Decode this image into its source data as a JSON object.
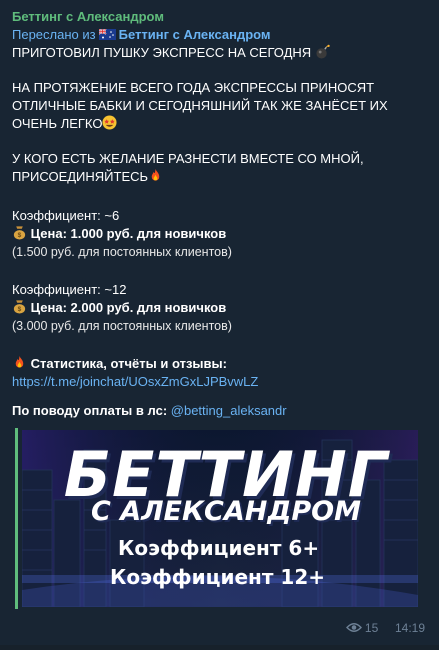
{
  "message": {
    "sender": "Беттинг с Александром",
    "forwarded_prefix": "Переслано из",
    "forwarded_from": "Беттинг с Александром",
    "lines": {
      "l1": "ПРИГОТОВИЛ ПУШКУ ЭКСПРЕСС НА СЕГОДНЯ",
      "l2": "НА ПРОТЯЖЕНИЕ ВСЕГО ГОДА ЭКСПРЕССЫ ПРИНОСЯТ",
      "l3": "ОТЛИЧНЫЕ БАБКИ И СЕГОДНЯШНИЙ ТАК ЖЕ ЗАНЁСЕТ ИХ",
      "l4": "ОЧЕНЬ ЛЕГКО",
      "l5": "У КОГО ЕСТЬ ЖЕЛАНИЕ РАЗНЕСТИ  ВМЕСТЕ СО МНОЙ,",
      "l6": "ПРИСОЕДИНЯЙТЕСЬ",
      "c1": "Коэффициент: ~6",
      "p1": "Цена: 1.000 руб. для новичков",
      "r1": "(1.500 руб. для постоянных клиентов)",
      "c2": "Коэффициент: ~12",
      "p2": "Цена: 2.000 руб. для новичков",
      "r2": "(3.000 руб. для постоянных клиентов)",
      "stats": "Статистика, отчёты и отзывы:",
      "link": "https://t.me/joinchat/UOsxZmGxLJPBvwLZ",
      "payment_prefix": "По поводу оплаты в лс: ",
      "payment_handle": "@betting_aleksandr"
    },
    "banner": {
      "title": "БЕТТИНГ",
      "subtitle": "С АЛЕКСАНДРОМ",
      "coef1": "Коэффициент 6+",
      "coef2": "Коэффициент 12+"
    },
    "views": "15",
    "time": "14:19"
  },
  "colors": {
    "background": "#182533",
    "sender": "#5fbc7c",
    "link": "#6ab3f3",
    "meta": "#6d8095"
  }
}
